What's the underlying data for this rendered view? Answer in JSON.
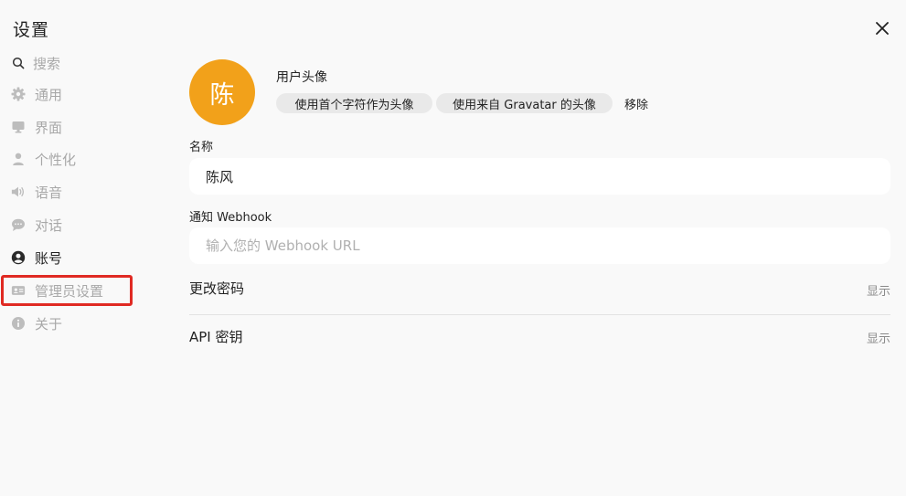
{
  "window": {
    "title": "设置"
  },
  "sidebar": {
    "items": [
      {
        "label": "搜索",
        "icon": "search-icon"
      },
      {
        "label": "通用",
        "icon": "gear-icon"
      },
      {
        "label": "界面",
        "icon": "monitor-icon"
      },
      {
        "label": "个性化",
        "icon": "person-icon"
      },
      {
        "label": "语音",
        "icon": "speaker-icon"
      },
      {
        "label": "对话",
        "icon": "chat-bubble-icon"
      },
      {
        "label": "账号",
        "icon": "account-circle-icon"
      },
      {
        "label": "管理员设置",
        "icon": "id-card-icon"
      },
      {
        "label": "关于",
        "icon": "info-icon"
      }
    ],
    "active": "账号",
    "highlighted": "管理员设置"
  },
  "account": {
    "avatar": {
      "initial": "陈",
      "color": "#f2a11a"
    },
    "avatar_title": "用户头像",
    "avatar_options": [
      "使用首个字符作为头像",
      "使用来自 Gravatar 的头像"
    ],
    "remove_label": "移除",
    "name_label": "名称",
    "name_value": "陈风",
    "webhook_label": "通知 Webhook",
    "webhook_placeholder": "输入您的 Webhook URL",
    "change_password_label": "更改密码",
    "change_password_action": "显示",
    "api_key_label": "API 密钥",
    "api_key_action": "显示"
  },
  "colors": {
    "highlight": "#e02a23",
    "avatar": "#f2a11a",
    "background": "#f9f9f9"
  }
}
